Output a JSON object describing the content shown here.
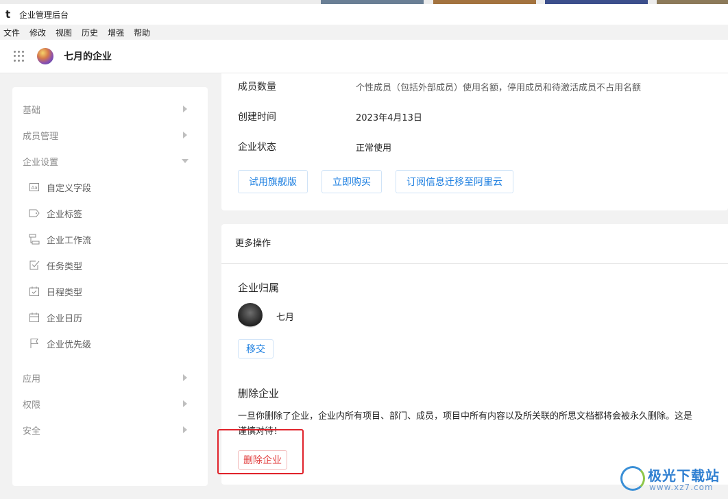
{
  "window": {
    "title": "企业管理后台"
  },
  "menubar": [
    "文件",
    "修改",
    "视图",
    "历史",
    "增强",
    "帮助"
  ],
  "header": {
    "org_name": "七月的企业"
  },
  "sidebar": {
    "groups_top": [
      {
        "label": "基础"
      },
      {
        "label": "成员管理"
      },
      {
        "label": "企业设置"
      }
    ],
    "sub_items": [
      {
        "label": "自定义字段",
        "icon": "custom-field-icon"
      },
      {
        "label": "企业标签",
        "icon": "tag-icon"
      },
      {
        "label": "企业工作流",
        "icon": "workflow-icon"
      },
      {
        "label": "任务类型",
        "icon": "task-check-icon"
      },
      {
        "label": "日程类型",
        "icon": "schedule-check-icon"
      },
      {
        "label": "企业日历",
        "icon": "calendar-icon"
      },
      {
        "label": "企业优先级",
        "icon": "flag-icon"
      }
    ],
    "groups_bottom": [
      {
        "label": "应用"
      },
      {
        "label": "权限"
      },
      {
        "label": "安全"
      }
    ]
  },
  "info": {
    "members_label": "成员数量",
    "members_value": "个性成员（包括外部成员）使用名额，停用成员和待激活成员不占用名额",
    "created_label": "创建时间",
    "created_value": "2023年4月13日",
    "status_label": "企业状态",
    "status_value": "正常使用",
    "buttons": {
      "trial": "试用旗舰版",
      "buy": "立即购买",
      "migrate": "订阅信息迁移至阿里云"
    }
  },
  "more": {
    "title": "更多操作",
    "ownership_title": "企业归属",
    "owner_name": "七月",
    "transfer_label": "移交",
    "delete_title": "删除企业",
    "delete_warning_line1": "一旦你删除了企业，企业内所有项目、部门、成员，项目中所有内容以及所关联的所思文档都将会被永久删除。这是",
    "delete_warning_line2": "谨慎对待！",
    "delete_button": "删除企业"
  },
  "watermark": {
    "name": "极光下载站",
    "url": "www.xz7.com"
  },
  "colors": {
    "accent": "#1b7ee0",
    "danger": "#e03b3b",
    "highlight": "#e0222a"
  }
}
